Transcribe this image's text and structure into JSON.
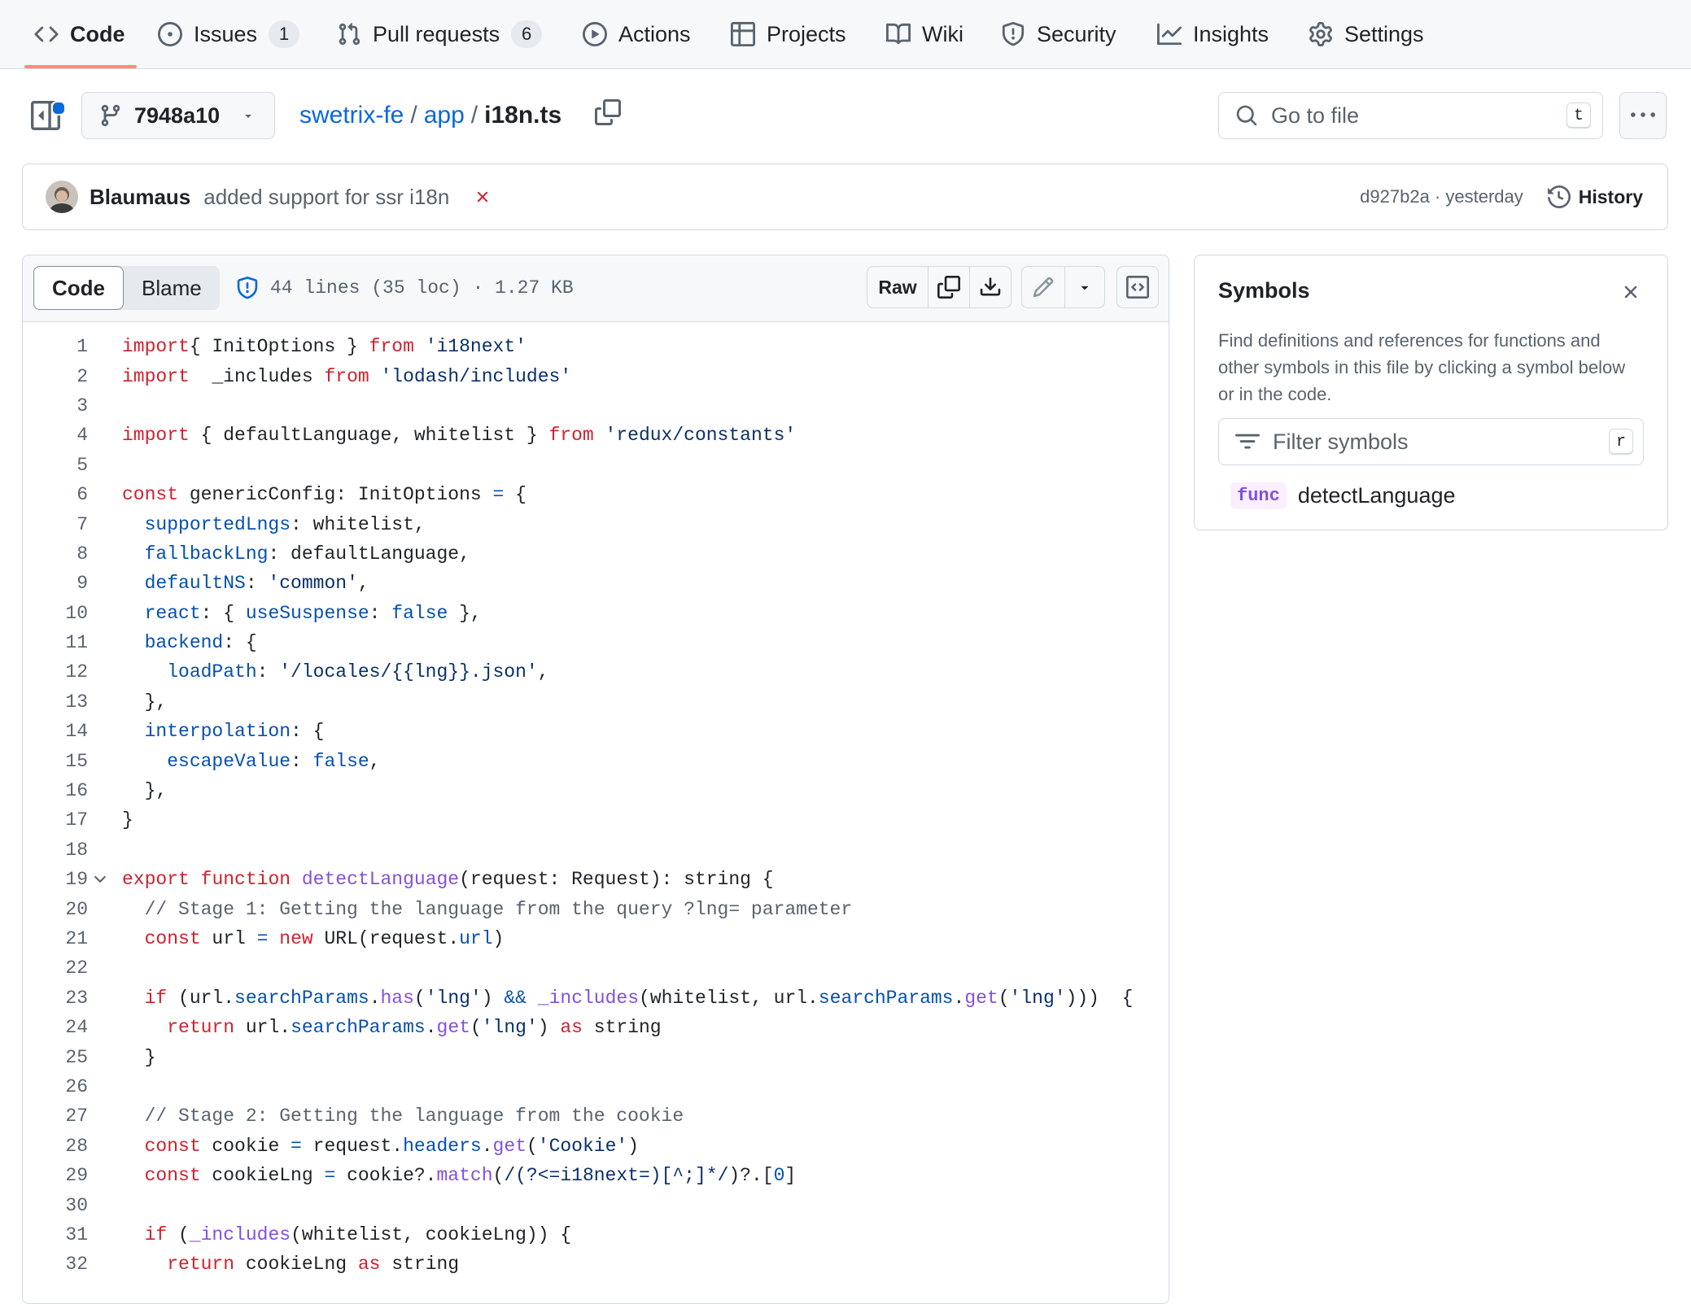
{
  "nav": {
    "code": "Code",
    "issues": "Issues",
    "issues_count": "1",
    "pulls": "Pull requests",
    "pulls_count": "6",
    "actions": "Actions",
    "projects": "Projects",
    "wiki": "Wiki",
    "security": "Security",
    "insights": "Insights",
    "settings": "Settings"
  },
  "branch": {
    "name": "7948a10"
  },
  "breadcrumb": {
    "repo": "swetrix-fe",
    "sep": "/",
    "dir": "app",
    "file": "i18n.ts"
  },
  "goto": {
    "placeholder": "Go to file",
    "shortcut": "t"
  },
  "commit": {
    "author": "Blaumaus",
    "message": "added support for ssr i18n",
    "meta": "d927b2a · yesterday",
    "history": "History"
  },
  "code_view": {
    "tab_code": "Code",
    "tab_blame": "Blame",
    "info": "44 lines (35 loc) · 1.27 KB",
    "raw": "Raw"
  },
  "symbols": {
    "title": "Symbols",
    "description": "Find definitions and references for functions and other symbols in this file by clicking a symbol below or in the code.",
    "filter_placeholder": "Filter symbols",
    "filter_shortcut": "r",
    "items": [
      {
        "kind": "func",
        "name": "detectLanguage"
      }
    ]
  },
  "code_lines": [
    [
      [
        "kw",
        "import"
      ],
      [
        "",
        "{ InitOptions } "
      ],
      [
        "kw",
        "from"
      ],
      [
        "",
        " "
      ],
      [
        "str",
        "'i18next'"
      ]
    ],
    [
      [
        "kw",
        "import"
      ],
      [
        "",
        "",
        " "
      ],
      [
        "",
        " _includes "
      ],
      [
        "kw",
        "from"
      ],
      [
        "",
        " "
      ],
      [
        "str",
        "'lodash/includes'"
      ]
    ],
    [],
    [
      [
        "kw",
        "import"
      ],
      [
        "",
        " { defaultLanguage, whitelist } "
      ],
      [
        "kw",
        "from"
      ],
      [
        "",
        " "
      ],
      [
        "str",
        "'redux/constants'"
      ]
    ],
    [],
    [
      [
        "kw",
        "const"
      ],
      [
        "",
        " genericConfig: InitOptions "
      ],
      [
        "op",
        "="
      ],
      [
        "",
        " {"
      ]
    ],
    [
      [
        "",
        "  "
      ],
      [
        "prop",
        "supportedLngs"
      ],
      [
        "",
        ": whitelist,"
      ]
    ],
    [
      [
        "",
        "  "
      ],
      [
        "prop",
        "fallbackLng"
      ],
      [
        "",
        ": defaultLanguage,"
      ]
    ],
    [
      [
        "",
        "  "
      ],
      [
        "prop",
        "defaultNS"
      ],
      [
        "",
        ": "
      ],
      [
        "str",
        "'common'"
      ],
      [
        "",
        ","
      ]
    ],
    [
      [
        "",
        "  "
      ],
      [
        "prop",
        "react"
      ],
      [
        "",
        ": { "
      ],
      [
        "prop",
        "useSuspense"
      ],
      [
        "",
        ": "
      ],
      [
        "prop",
        "false"
      ],
      [
        "",
        " },"
      ]
    ],
    [
      [
        "",
        "  "
      ],
      [
        "prop",
        "backend"
      ],
      [
        "",
        ": {"
      ]
    ],
    [
      [
        "",
        "    "
      ],
      [
        "prop",
        "loadPath"
      ],
      [
        "",
        ": "
      ],
      [
        "str",
        "'/locales/{{lng}}.json'"
      ],
      [
        "",
        ","
      ]
    ],
    [
      [
        "",
        "  },"
      ]
    ],
    [
      [
        "",
        "  "
      ],
      [
        "prop",
        "interpolation"
      ],
      [
        "",
        ": {"
      ]
    ],
    [
      [
        "",
        "    "
      ],
      [
        "prop",
        "escapeValue"
      ],
      [
        "",
        ": "
      ],
      [
        "prop",
        "false"
      ],
      [
        "",
        ","
      ]
    ],
    [
      [
        "",
        "  },"
      ]
    ],
    [
      [
        "",
        "}"
      ]
    ],
    [],
    [
      [
        "kw",
        "export"
      ],
      [
        "",
        " "
      ],
      [
        "kw",
        "function"
      ],
      [
        "",
        " "
      ],
      [
        "fn",
        "detectLanguage"
      ],
      [
        "",
        "(request: Request): string {"
      ]
    ],
    [
      [
        "",
        "  "
      ],
      [
        "cm",
        "// Stage 1: Getting the language from the query ?lng= parameter"
      ]
    ],
    [
      [
        "",
        "  "
      ],
      [
        "kw",
        "const"
      ],
      [
        "",
        " url "
      ],
      [
        "op",
        "="
      ],
      [
        "",
        " "
      ],
      [
        "kw",
        "new"
      ],
      [
        "",
        " URL(request."
      ],
      [
        "prop",
        "url"
      ],
      [
        "",
        ")"
      ]
    ],
    [],
    [
      [
        "",
        "  "
      ],
      [
        "kw",
        "if"
      ],
      [
        "",
        " (url."
      ],
      [
        "prop",
        "searchParams"
      ],
      [
        "",
        "."
      ],
      [
        "fn",
        "has"
      ],
      [
        "",
        "("
      ],
      [
        "str",
        "'lng'"
      ],
      [
        "",
        ") "
      ],
      [
        "op",
        "&&"
      ],
      [
        "",
        " "
      ],
      [
        "fn",
        "_includes"
      ],
      [
        "",
        "(whitelist, url."
      ],
      [
        "prop",
        "searchParams"
      ],
      [
        "",
        "."
      ],
      [
        "fn",
        "get"
      ],
      [
        "",
        "("
      ],
      [
        "str",
        "'lng'"
      ],
      [
        "",
        ")))  {"
      ]
    ],
    [
      [
        "",
        "    "
      ],
      [
        "kw",
        "return"
      ],
      [
        "",
        " url."
      ],
      [
        "prop",
        "searchParams"
      ],
      [
        "",
        "."
      ],
      [
        "fn",
        "get"
      ],
      [
        "",
        "("
      ],
      [
        "str",
        "'lng'"
      ],
      [
        "",
        ") "
      ],
      [
        "kw",
        "as"
      ],
      [
        "",
        " string"
      ]
    ],
    [
      [
        "",
        "  }"
      ]
    ],
    [],
    [
      [
        "",
        "  "
      ],
      [
        "cm",
        "// Stage 2: Getting the language from the cookie"
      ]
    ],
    [
      [
        "",
        "  "
      ],
      [
        "kw",
        "const"
      ],
      [
        "",
        " cookie "
      ],
      [
        "op",
        "="
      ],
      [
        "",
        " request."
      ],
      [
        "prop",
        "headers"
      ],
      [
        "",
        "."
      ],
      [
        "fn",
        "get"
      ],
      [
        "",
        "("
      ],
      [
        "str",
        "'Cookie'"
      ],
      [
        "",
        ")"
      ]
    ],
    [
      [
        "",
        "  "
      ],
      [
        "kw",
        "const"
      ],
      [
        "",
        " cookieLng "
      ],
      [
        "op",
        "="
      ],
      [
        "",
        " cookie?."
      ],
      [
        "fn",
        "match"
      ],
      [
        "",
        "("
      ],
      [
        "str",
        "/(?<=i18next=)[^;]*/"
      ],
      [
        "",
        ")?.["
      ],
      [
        "prop",
        "0"
      ],
      [
        "",
        "]"
      ]
    ],
    [],
    [
      [
        "",
        "  "
      ],
      [
        "kw",
        "if"
      ],
      [
        "",
        " ("
      ],
      [
        "fn",
        "_includes"
      ],
      [
        "",
        "(whitelist, cookieLng)) {"
      ]
    ],
    [
      [
        "",
        "    "
      ],
      [
        "kw",
        "return"
      ],
      [
        "",
        " cookieLng "
      ],
      [
        "kw",
        "as"
      ],
      [
        "",
        " string"
      ]
    ]
  ]
}
